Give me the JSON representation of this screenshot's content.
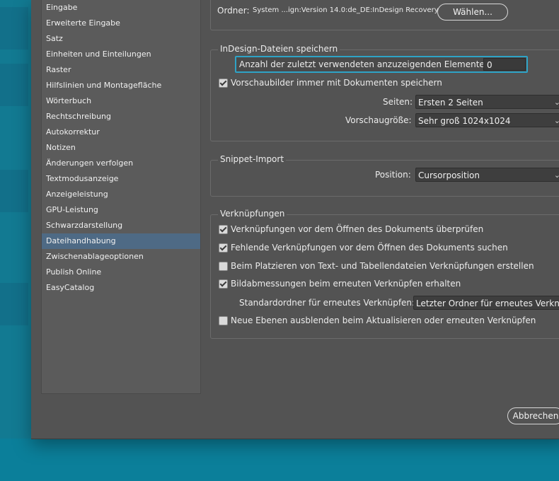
{
  "sidebar": {
    "items": [
      {
        "label": "Eingabe"
      },
      {
        "label": "Erweiterte Eingabe"
      },
      {
        "label": "Satz"
      },
      {
        "label": "Einheiten und Einteilungen"
      },
      {
        "label": "Raster"
      },
      {
        "label": "Hilfslinien und Montagefläche"
      },
      {
        "label": "Wörterbuch"
      },
      {
        "label": "Rechtschreibung"
      },
      {
        "label": "Autokorrektur"
      },
      {
        "label": "Notizen"
      },
      {
        "label": "Änderungen verfolgen"
      },
      {
        "label": "Textmodusanzeige"
      },
      {
        "label": "Anzeigeleistung"
      },
      {
        "label": "GPU-Leistung"
      },
      {
        "label": "Schwarzdarstellung"
      },
      {
        "label": "Dateihandhabung"
      },
      {
        "label": "Zwischenablageoptionen"
      },
      {
        "label": "Publish Online"
      },
      {
        "label": "EasyCatalog"
      }
    ],
    "selected": "Dateihandhabung"
  },
  "recovery": {
    "folder_label": "Ordner:",
    "folder_path": "System ...ign:Version 14.0:de_DE:InDesign Recovery",
    "choose_button": "Wählen..."
  },
  "save": {
    "title": "InDesign-Dateien speichern",
    "recent_label": "Anzahl der zuletzt verwendeten anzuzeigenden Elemente:",
    "recent_value": "0",
    "preview_checkbox": "Vorschaubilder immer mit Dokumenten speichern",
    "preview_checked": true,
    "pages_label": "Seiten:",
    "pages_value": "Ersten 2 Seiten",
    "size_label": "Vorschaugröße:",
    "size_value": "Sehr groß 1024x1024"
  },
  "snippet": {
    "title": "Snippet-Import",
    "position_label": "Position:",
    "position_value": "Cursorposition"
  },
  "links": {
    "title": "Verknüpfungen",
    "check_before_open": "Verknüpfungen vor dem Öffnen des Dokuments überprüfen",
    "check_before_open_checked": true,
    "find_missing": "Fehlende Verknüpfungen vor dem Öffnen des Dokuments suchen",
    "find_missing_checked": true,
    "create_on_place": "Beim Platzieren von Text- und Tabellendateien Verknüpfungen erstellen",
    "create_on_place_checked": false,
    "preserve_dimensions": "Bildabmessungen beim erneuten Verknüpfen erhalten",
    "preserve_dimensions_checked": true,
    "default_folder_label": "Standardordner für erneutes Verknüpfen:",
    "default_folder_value": "Letzter Ordner für erneutes Verknüpfen",
    "hide_layers": "Neue Ebenen ausblenden beim Aktualisieren oder erneuten Verknüpfen",
    "hide_layers_checked": false
  },
  "footer": {
    "cancel_button": "Abbrechen"
  },
  "colors": {
    "desktop": "#0b7f9a",
    "dialog": "#535353",
    "selection": "#4e6a85",
    "focus_ring": "#2ea3c6"
  }
}
